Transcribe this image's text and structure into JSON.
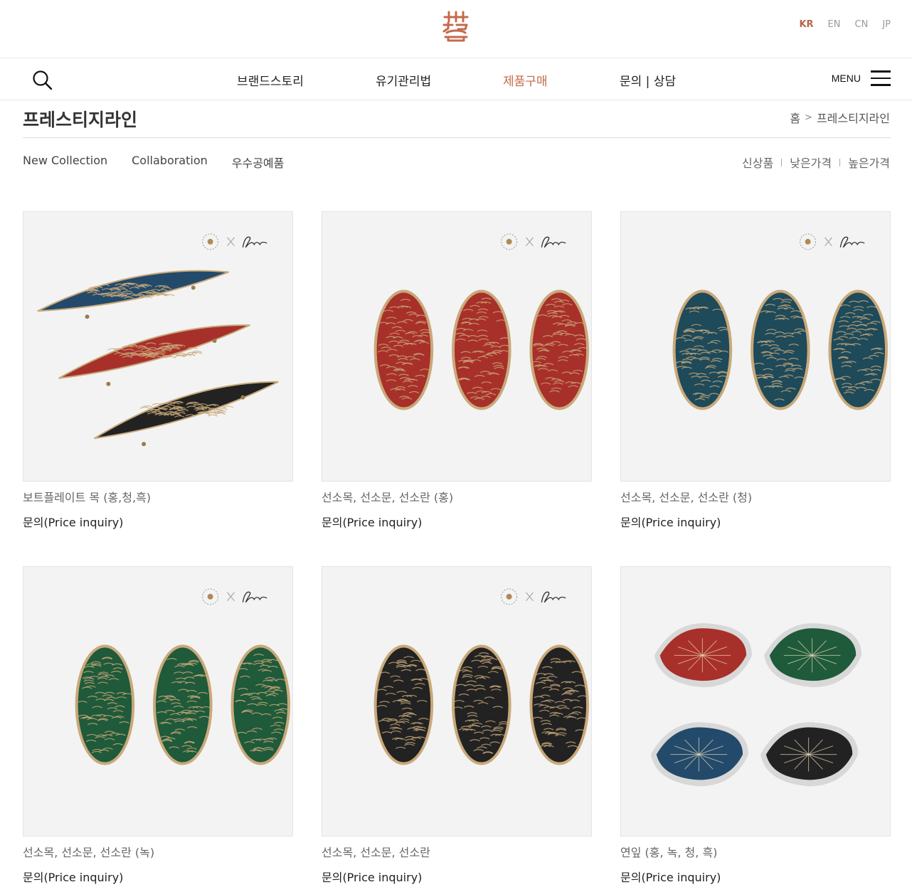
{
  "header": {
    "languages": [
      {
        "code": "KR",
        "active": true
      },
      {
        "code": "EN",
        "active": false
      },
      {
        "code": "CN",
        "active": false
      },
      {
        "code": "JP",
        "active": false
      }
    ]
  },
  "nav": {
    "items": [
      {
        "label": "브랜드스토리",
        "active": false
      },
      {
        "label": "유기관리법",
        "active": false
      },
      {
        "label": "제품구매",
        "active": true
      },
      {
        "label": "문의 | 상담",
        "active": false
      }
    ],
    "menu_label": "MENU"
  },
  "page": {
    "title": "프레스티지라인",
    "breadcrumb": [
      "홈",
      "프레스티지라인"
    ]
  },
  "categories": [
    "New Collection",
    "Collaboration",
    "우수공예품"
  ],
  "sort_links": [
    "신상품",
    "낮은가격",
    "높은가격"
  ],
  "products": [
    {
      "name": "보트플레이트 목 (홍,청,흑)",
      "price": "문의(Price inquiry)",
      "image": "boat-plates"
    },
    {
      "name": "선소목, 선소문, 선소란 (홍)",
      "price": "문의(Price inquiry)",
      "image": "oval-plates-red"
    },
    {
      "name": "선소목, 선소문, 선소란 (청)",
      "price": "문의(Price inquiry)",
      "image": "oval-plates-blue"
    },
    {
      "name": "선소목, 선소문, 선소란 (녹)",
      "price": "문의(Price inquiry)",
      "image": "oval-plates-green"
    },
    {
      "name": "선소목, 선소문, 선소란",
      "price": "문의(Price inquiry)",
      "image": "oval-plates-black"
    },
    {
      "name": "연잎 (홍, 녹, 청, 흑)",
      "price": "문의(Price inquiry)",
      "image": "lotus-leaf-bowls"
    }
  ],
  "colors": {
    "accent": "#c46a4c",
    "red": "#a8302a",
    "blue": "#234a6a",
    "teal": "#1e4a5a",
    "green": "#1f5a3a",
    "black": "#222222",
    "brass": "#c9a97a"
  }
}
